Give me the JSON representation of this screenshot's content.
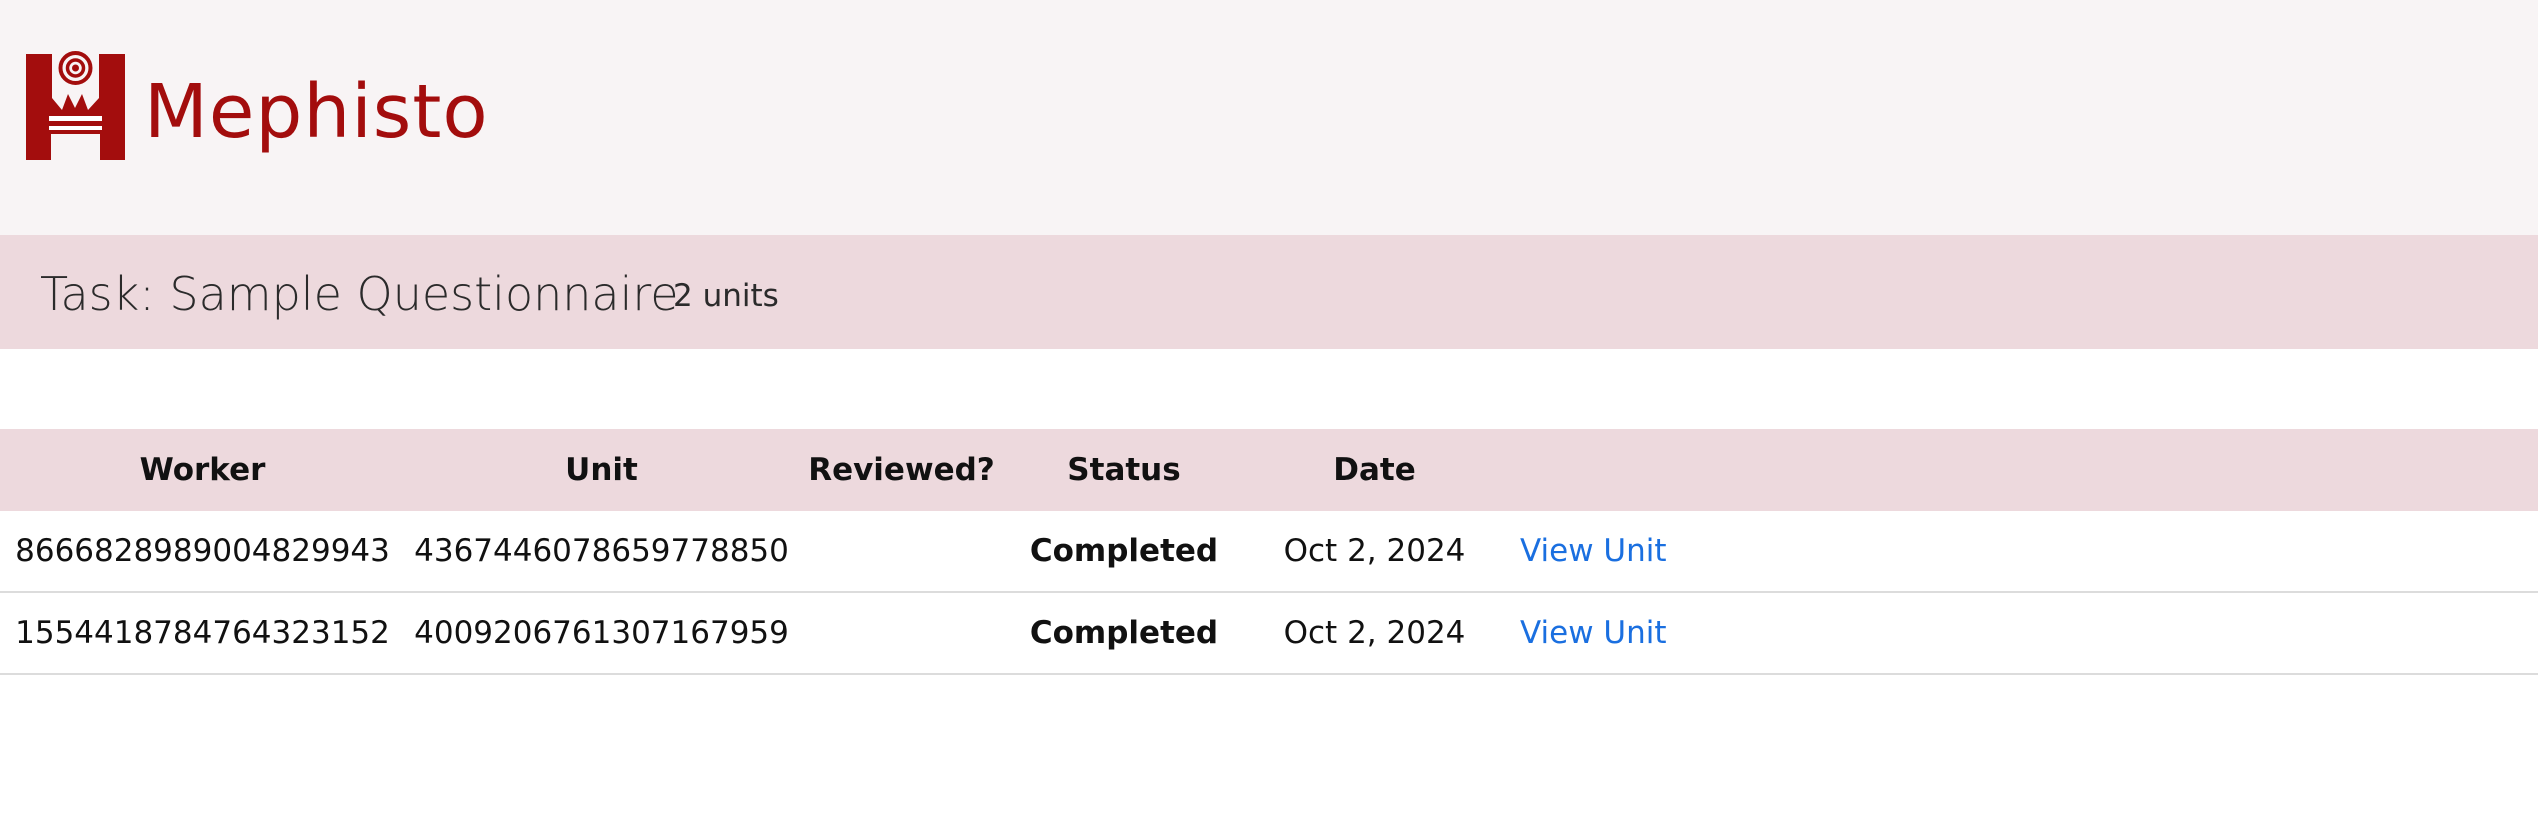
{
  "app": {
    "brand_name": "Mephisto",
    "brand_color": "#a30d0d"
  },
  "task": {
    "title": "Task: Sample Questionnaire",
    "unit_count": "2 units"
  },
  "table": {
    "headers": {
      "worker": "Worker",
      "unit": "Unit",
      "reviewed": "Reviewed?",
      "status": "Status",
      "date": "Date"
    },
    "rows": [
      {
        "worker": "8666828989004829943",
        "unit": "4367446078659778850",
        "reviewed": "",
        "status": "Completed",
        "date": "Oct 2, 2024",
        "action": "View Unit"
      },
      {
        "worker": "1554418784764323152",
        "unit": "4009206761307167959",
        "reviewed": "",
        "status": "Completed",
        "date": "Oct 2, 2024",
        "action": "View Unit"
      }
    ]
  },
  "colors": {
    "header_bg": "#f8f4f5",
    "band_bg": "#edd9dd",
    "link": "#1a6fe0"
  },
  "icons": {
    "logo": "mephisto-logo-icon"
  }
}
